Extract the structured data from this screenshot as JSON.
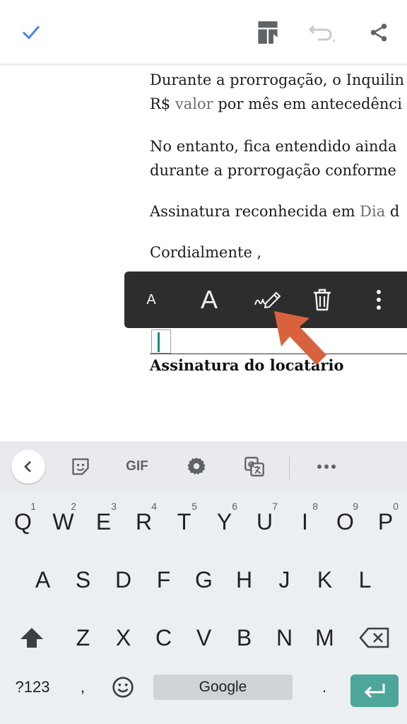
{
  "toolbar": {
    "icons": [
      "check-icon",
      "layout-icon",
      "undo-icon",
      "share-icon"
    ],
    "accent_color": "#4a86e8"
  },
  "document": {
    "paragraphs": [
      {
        "lines": [
          {
            "text": "Durante a prorrogação, o Inquilin"
          },
          {
            "prefix": "R$ ",
            "field": "valor",
            "suffix": " por mês em antecedênci"
          }
        ]
      },
      {
        "lines": [
          {
            "text": "No entanto, fica entendido ainda"
          },
          {
            "text": "durante a prorrogação conforme"
          }
        ]
      },
      {
        "lines": [
          {
            "prefix": "Assinatura reconhecida em ",
            "field": "Dia",
            "suffix": " d"
          }
        ]
      },
      {
        "lines": [
          {
            "text": "Cordialmente ,"
          }
        ]
      }
    ],
    "signature_label": "Assinatura do locatário"
  },
  "context_toolbar": {
    "small_font_label": "A",
    "large_font_label": "A",
    "icons": [
      "font-decrease-icon",
      "font-increase-icon",
      "signature-pen-icon",
      "trash-icon",
      "more-vert-icon"
    ]
  },
  "annotation_arrow_color": "#d9623e",
  "keyboard": {
    "strip_icons": [
      "chevron-left-icon",
      "sticker-icon",
      "gif-icon",
      "settings-icon",
      "translate-icon",
      "more-horiz-icon"
    ],
    "gif_label": "GIF",
    "row1": [
      {
        "key": "Q",
        "hint": "1"
      },
      {
        "key": "W",
        "hint": "2"
      },
      {
        "key": "E",
        "hint": "3"
      },
      {
        "key": "R",
        "hint": "4"
      },
      {
        "key": "T",
        "hint": "5"
      },
      {
        "key": "Y",
        "hint": "6"
      },
      {
        "key": "U",
        "hint": "7"
      },
      {
        "key": "I",
        "hint": "8"
      },
      {
        "key": "O",
        "hint": "9"
      },
      {
        "key": "P",
        "hint": "0"
      }
    ],
    "row2": [
      "A",
      "S",
      "D",
      "F",
      "G",
      "H",
      "J",
      "K",
      "L"
    ],
    "row3": [
      "Z",
      "X",
      "C",
      "V",
      "B",
      "N",
      "M"
    ],
    "symbols_label": "?123",
    "comma_label": ",",
    "space_label": "Google",
    "period_label": ".",
    "enter_color": "#4ea69a"
  }
}
